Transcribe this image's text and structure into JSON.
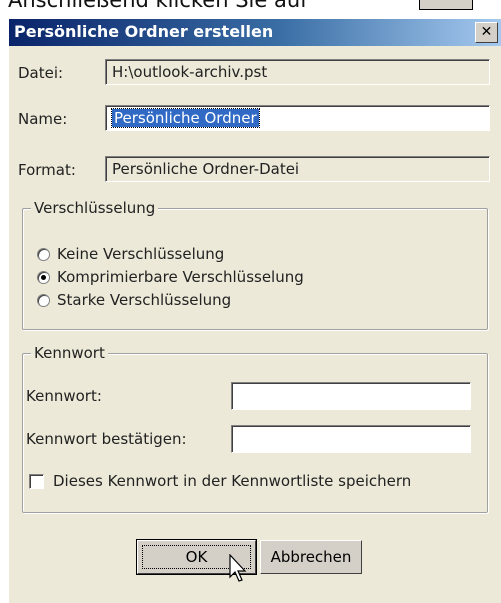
{
  "top_caption": "Anschließend klicken Sie auf",
  "dialog": {
    "title": "Persönliche Ordner erstellen",
    "close_glyph": "✕",
    "datei": {
      "label": "Datei:",
      "value": "H:\\outlook-archiv.pst"
    },
    "name": {
      "label": "Name:",
      "value": "Persönliche Ordner"
    },
    "format": {
      "label": "Format:",
      "value": "Persönliche Ordner-Datei"
    },
    "encryption": {
      "legend": "Verschlüsselung",
      "options": [
        {
          "label": "Keine Verschlüsselung",
          "checked": false
        },
        {
          "label": "Komprimierbare Verschlüsselung",
          "checked": true
        },
        {
          "label": "Starke Verschlüsselung",
          "checked": false
        }
      ]
    },
    "password": {
      "legend": "Kennwort",
      "password_label": "Kennwort:",
      "password_value": "",
      "confirm_label": "Kennwort bestätigen:",
      "confirm_value": "",
      "save_checkbox_label": "Dieses Kennwort in der Kennwortliste speichern",
      "save_checked": false
    },
    "buttons": {
      "ok": "OK",
      "cancel": "Abbrechen"
    }
  },
  "colors": {
    "title_start": "#0a246a",
    "title_end": "#a6caf0",
    "dialog_bg": "#ece9d8",
    "selection": "#316ac5"
  },
  "icons": {
    "cursor": "arrow-pointer-icon"
  }
}
